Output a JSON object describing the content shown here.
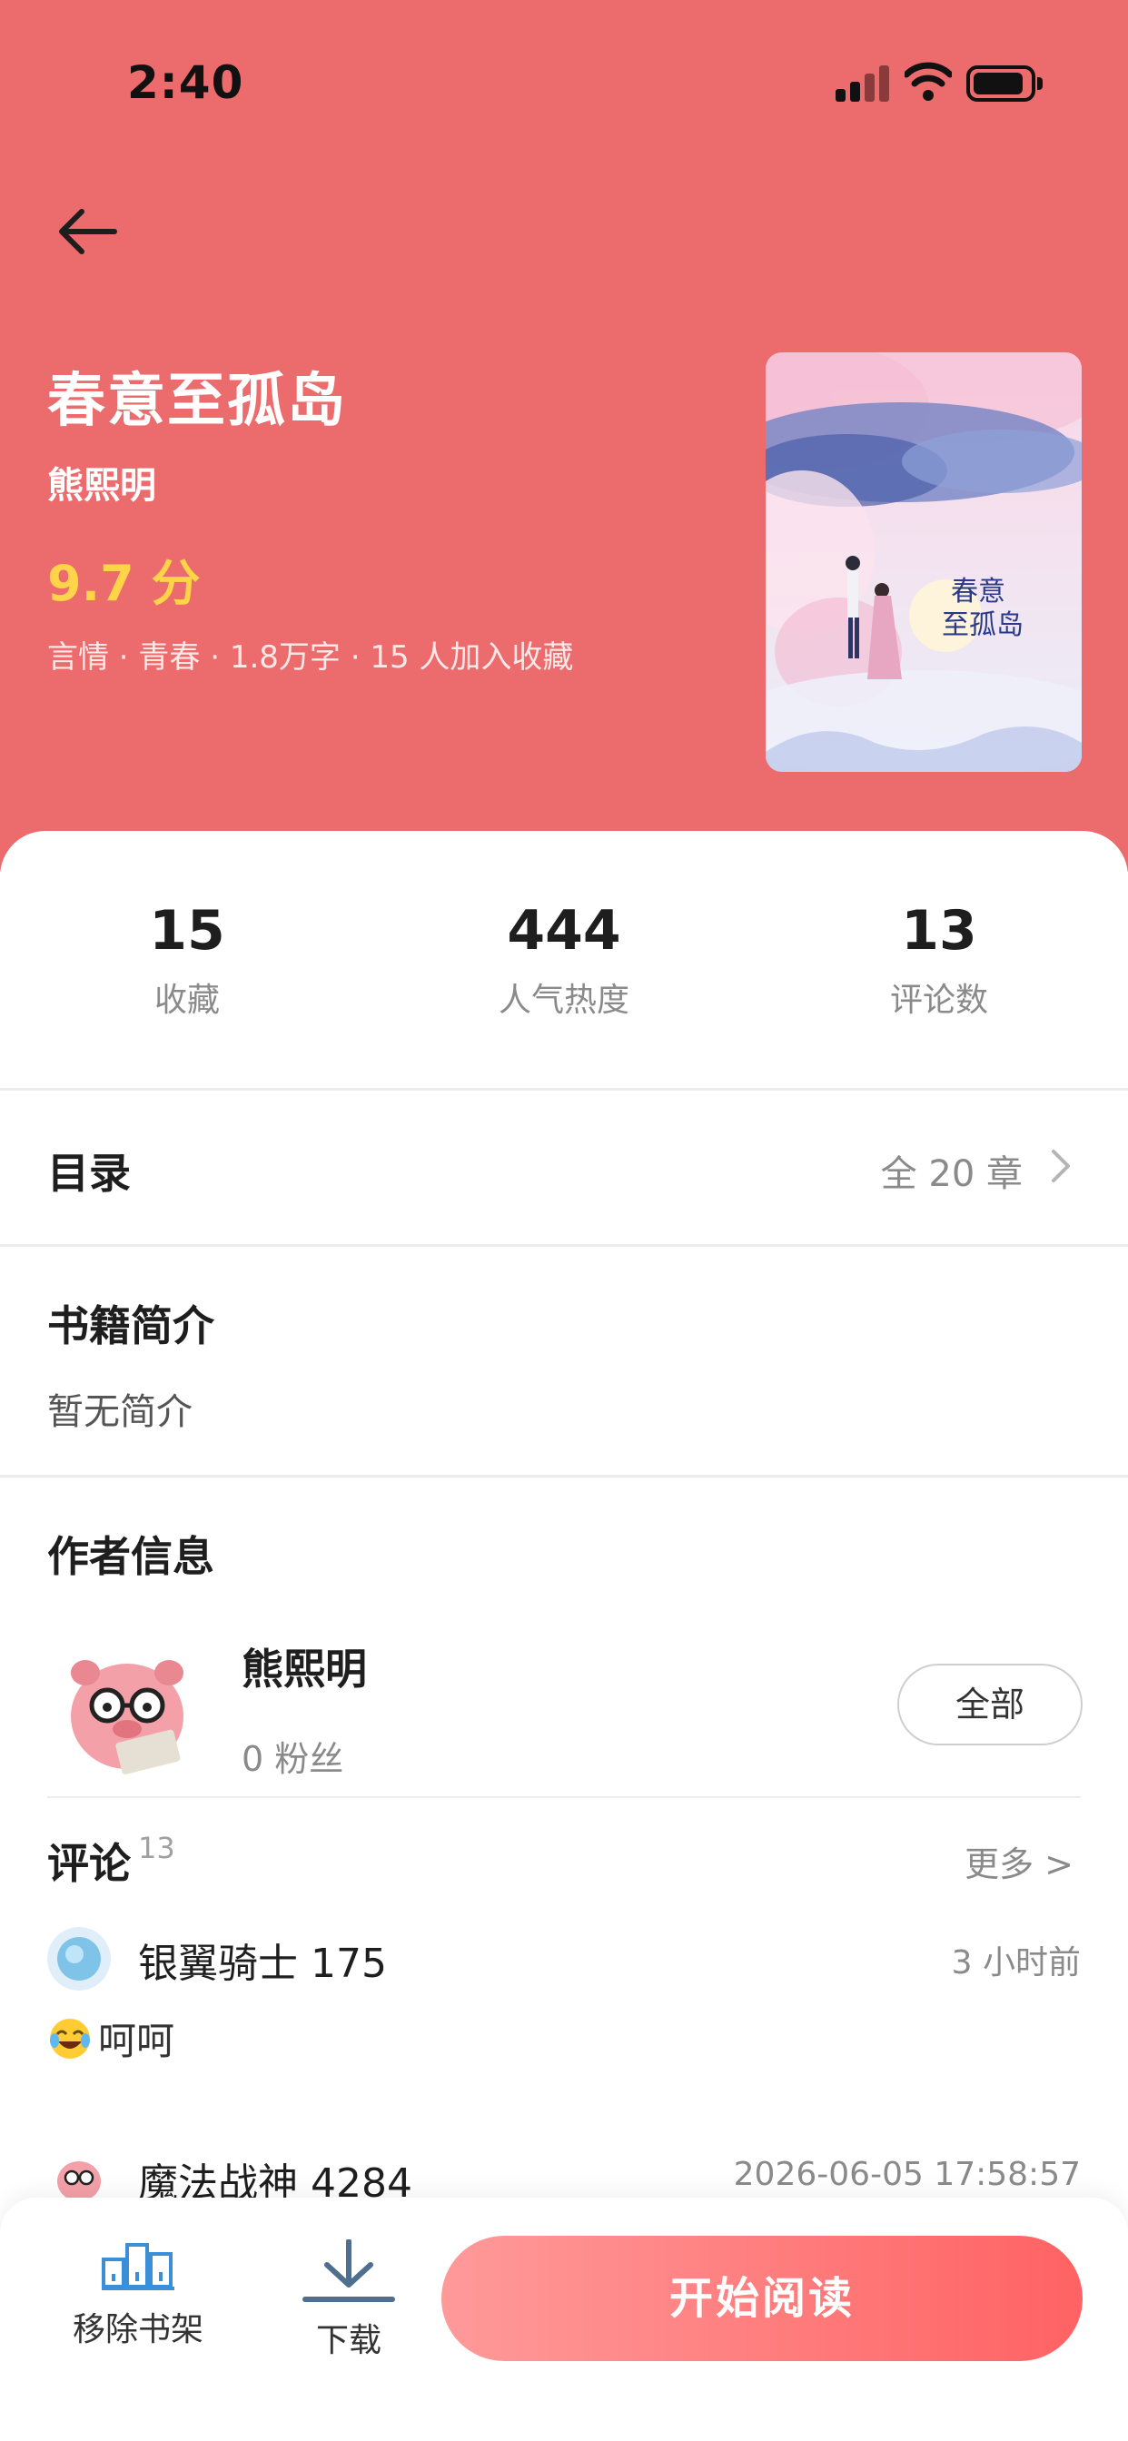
{
  "status_bar": {
    "time": "2:40"
  },
  "book": {
    "title": "春意至孤岛",
    "author": "熊熙明",
    "score": "9.7 分",
    "meta": "言情 · 青春 · 1.8万字 · 15 人加入收藏",
    "cover_title_line1": "春意",
    "cover_title_line2": "至孤岛"
  },
  "stats": [
    {
      "value": "15",
      "label": "收藏"
    },
    {
      "value": "444",
      "label": "人气热度"
    },
    {
      "value": "13",
      "label": "评论数"
    }
  ],
  "toc": {
    "title": "目录",
    "count": "全 20 章"
  },
  "intro": {
    "title": "书籍简介",
    "text": "暂无简介"
  },
  "author_info": {
    "title": "作者信息",
    "name": "熊熙明",
    "fans": "0 粉丝",
    "all_button": "全部"
  },
  "comments": {
    "title": "评论",
    "count": "13",
    "more": "更多 >",
    "items": [
      {
        "user": "银翼骑士 175",
        "time": "3 小时前",
        "text": "呵呵",
        "emoji": "tears-of-joy-emoji"
      },
      {
        "user": "魔法战神 4284",
        "time": "2026-06-05 17:58:57"
      }
    ]
  },
  "bottom_bar": {
    "remove_label": "移除书架",
    "download_label": "下载",
    "start_label": "开始阅读"
  },
  "colors": {
    "hero_bg": "#ec6b6c",
    "score": "#ffd449",
    "start_gradient_from": "#ff9a9a",
    "start_gradient_to": "#ff6263",
    "icon_blue": "#3b8fd9"
  }
}
